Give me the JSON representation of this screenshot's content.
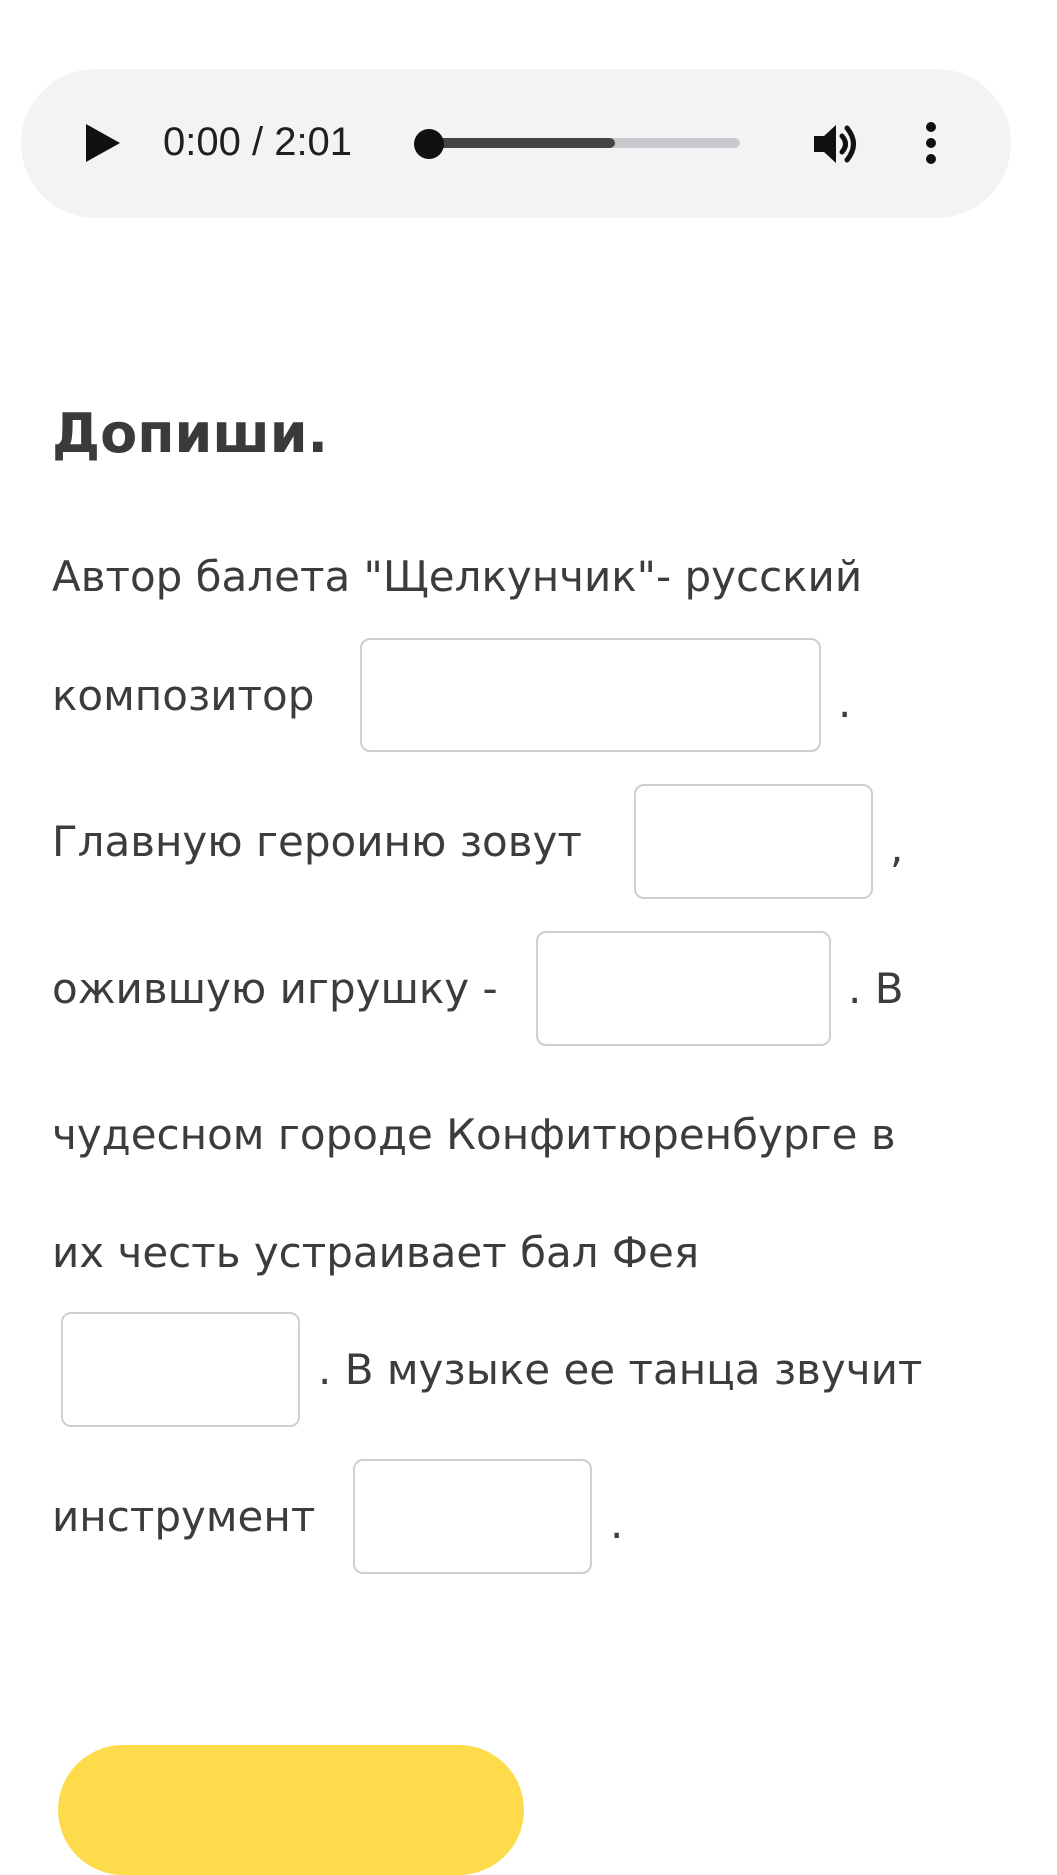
{
  "player": {
    "time_display": "0:00 / 2:01",
    "progress_fraction": 0.0,
    "buffered_fraction": 0.6,
    "play_icon": "play-icon",
    "volume_icon": "volume-icon",
    "more_icon": "more-vertical-icon"
  },
  "task": {
    "title": "Допиши.",
    "segments": {
      "s1": "Автор балета \"Щелкунчик\"- русский",
      "s2": "композитор",
      "s3": ".",
      "s4": "Главную героиню зовут",
      "s5": ",",
      "s6": "ожившую игрушку -",
      "s7": ".  В",
      "s8": "чудесном городе Конфитюренбурге в",
      "s9": "их честь устраивает бал Фея",
      "s10": ".  В музыке ее танца звучит",
      "s11": "инструмент",
      "s12": "."
    },
    "blanks": {
      "composer": "",
      "heroine": "",
      "toy": "",
      "fairy": "",
      "instrument": ""
    }
  },
  "colors": {
    "player_bg": "#f1f3f4",
    "accent_yellow": "#fddb4b",
    "text": "#3c3c3c",
    "blank_border": "#cfcfcf"
  }
}
